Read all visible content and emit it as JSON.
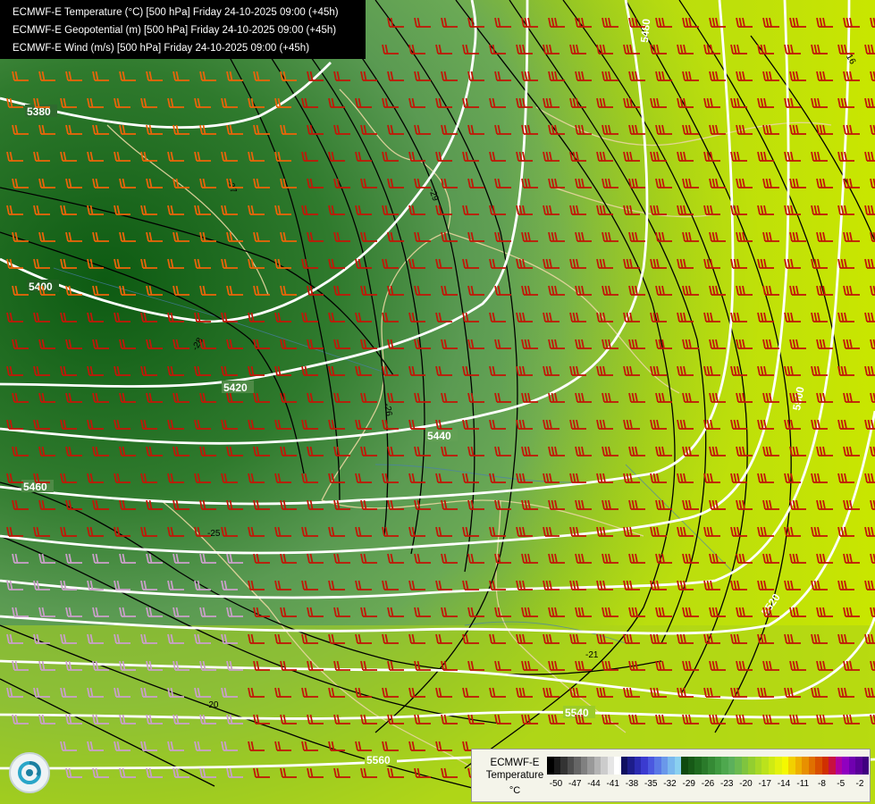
{
  "titles": {
    "line1": "ECMWF-E Temperature (°C) [500 hPa] Friday 24-10-2025 09:00 (+45h)",
    "line2": "ECMWF-E Geopotential (m) [500 hPa] Friday 24-10-2025 09:00 (+45h)",
    "line3": "ECMWF-E Wind (m/s) [500 hPa] Friday 24-10-2025 09:00 (+45h)"
  },
  "legend": {
    "name_line1": "ECMWF-E",
    "name_line2": "Temperature",
    "unit": "°C",
    "ticks": [
      "-50",
      "-47",
      "-44",
      "-41",
      "-38",
      "-35",
      "-32",
      "-29",
      "-26",
      "-23",
      "-20",
      "-17",
      "-14",
      "-11",
      "-8",
      "-5",
      "-2"
    ],
    "colors": [
      "#000000",
      "#1a1a1a",
      "#333333",
      "#4d4d4d",
      "#666666",
      "#808080",
      "#999999",
      "#b3b3b3",
      "#cccccc",
      "#e6e6e6",
      "#ffffff",
      "#101060",
      "#1d1d8a",
      "#2b2bb0",
      "#3b3bd0",
      "#4b58e0",
      "#5a78e6",
      "#6a98ea",
      "#7ab8ee",
      "#8ad0f0",
      "#0f4a0f",
      "#175a17",
      "#1f6a1f",
      "#2a7a2a",
      "#358a35",
      "#409a40",
      "#4ea84e",
      "#5cb05c",
      "#6bba50",
      "#7fc43f",
      "#93ce30",
      "#a7d826",
      "#bbe21c",
      "#cfea14",
      "#e3f20c",
      "#f5f800",
      "#f2d000",
      "#eeb000",
      "#e89000",
      "#e07000",
      "#d85000",
      "#d03000",
      "#c81040",
      "#b000a0",
      "#9000c0",
      "#7000b0",
      "#5a0098",
      "#400080"
    ]
  },
  "geopotential_labels": [
    "5380",
    "5400",
    "5420",
    "5440",
    "5460",
    "5480",
    "5500",
    "5520",
    "5540",
    "5560"
  ],
  "temperature_labels": [
    "-27",
    "-28",
    "-29",
    "-25",
    "-26",
    "-21",
    "-20",
    "-16"
  ]
}
